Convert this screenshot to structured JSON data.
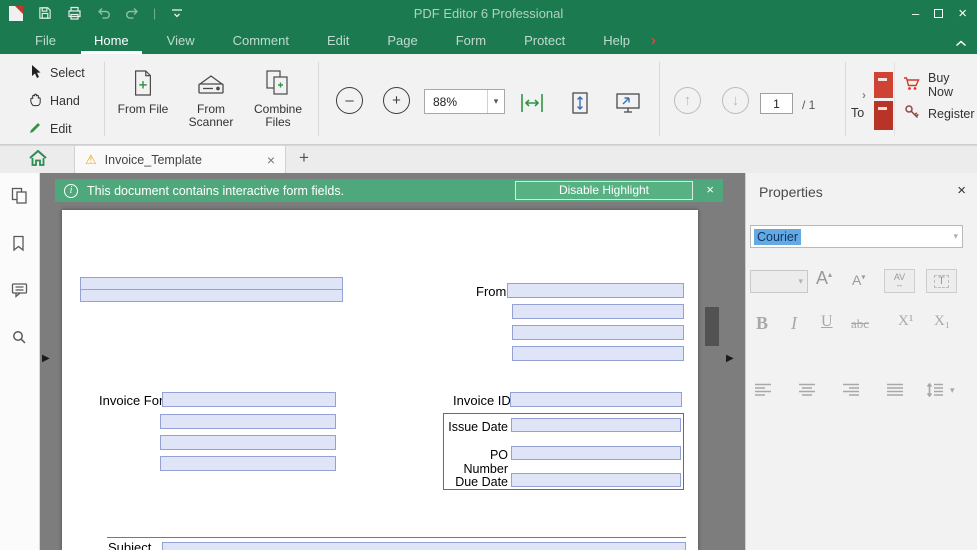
{
  "titlebar": {
    "title": "PDF Editor 6 Professional",
    "window_controls": {
      "minimize": "–",
      "close": "×"
    }
  },
  "menubar": {
    "items": [
      {
        "label": "File"
      },
      {
        "label": "Home"
      },
      {
        "label": "View"
      },
      {
        "label": "Comment"
      },
      {
        "label": "Edit"
      },
      {
        "label": "Page"
      },
      {
        "label": "Form"
      },
      {
        "label": "Protect"
      },
      {
        "label": "Help"
      }
    ],
    "overflow_arrow": "›"
  },
  "toolbar": {
    "select_label": "Select",
    "hand_label": "Hand",
    "edit_label": "Edit",
    "from_file_label": "From File",
    "from_scanner_label": "From Scanner",
    "combine_files_label": "Combine Files",
    "zoom_value": "88%",
    "page_current": "1",
    "page_total": "/ 1",
    "convert_label": "To",
    "convert_expand": "›",
    "buy_now_label": "Buy Now",
    "register_label": "Register"
  },
  "tabbar": {
    "active_tab_label": "Invoice_Template",
    "warning_icon": "⚠",
    "close_icon": "×",
    "new_tab_label": "+"
  },
  "notification": {
    "message": "This document contains interactive form fields.",
    "button_label": "Disable Highlight",
    "info_icon": "i",
    "close_icon": "×"
  },
  "document": {
    "labels": {
      "from": "From",
      "invoice_for": "Invoice For",
      "invoice_id": "Invoice ID",
      "issue_date": "Issue Date",
      "po_number": "PO Number",
      "due_date": "Due Date",
      "subject": "Subject"
    }
  },
  "properties_panel": {
    "title": "Properties",
    "font_name": "Courier",
    "bold": "B",
    "italic": "I",
    "underline": "U",
    "strikeout": "abc",
    "superscript": "X¹",
    "subscript": "X₁",
    "font_larger": "A",
    "font_larger_arrow": "▴",
    "font_smaller": "A",
    "font_smaller_arrow": "▾",
    "kerning": "AV",
    "kerning_arrow": "↔",
    "text_style": "T",
    "close_icon": "×"
  },
  "icons": {
    "dropdown": "▾",
    "up_arrow": "↑",
    "down_arrow": "↓",
    "minus": "–",
    "plus": "+"
  },
  "colors": {
    "brand_green": "#1b7a50",
    "notification_green": "#4fa87b",
    "field_fill": "#dfe5f7",
    "field_border": "#93a1d4",
    "accent_red": "#cf3a2b",
    "selection_blue": "#63a9e3"
  }
}
